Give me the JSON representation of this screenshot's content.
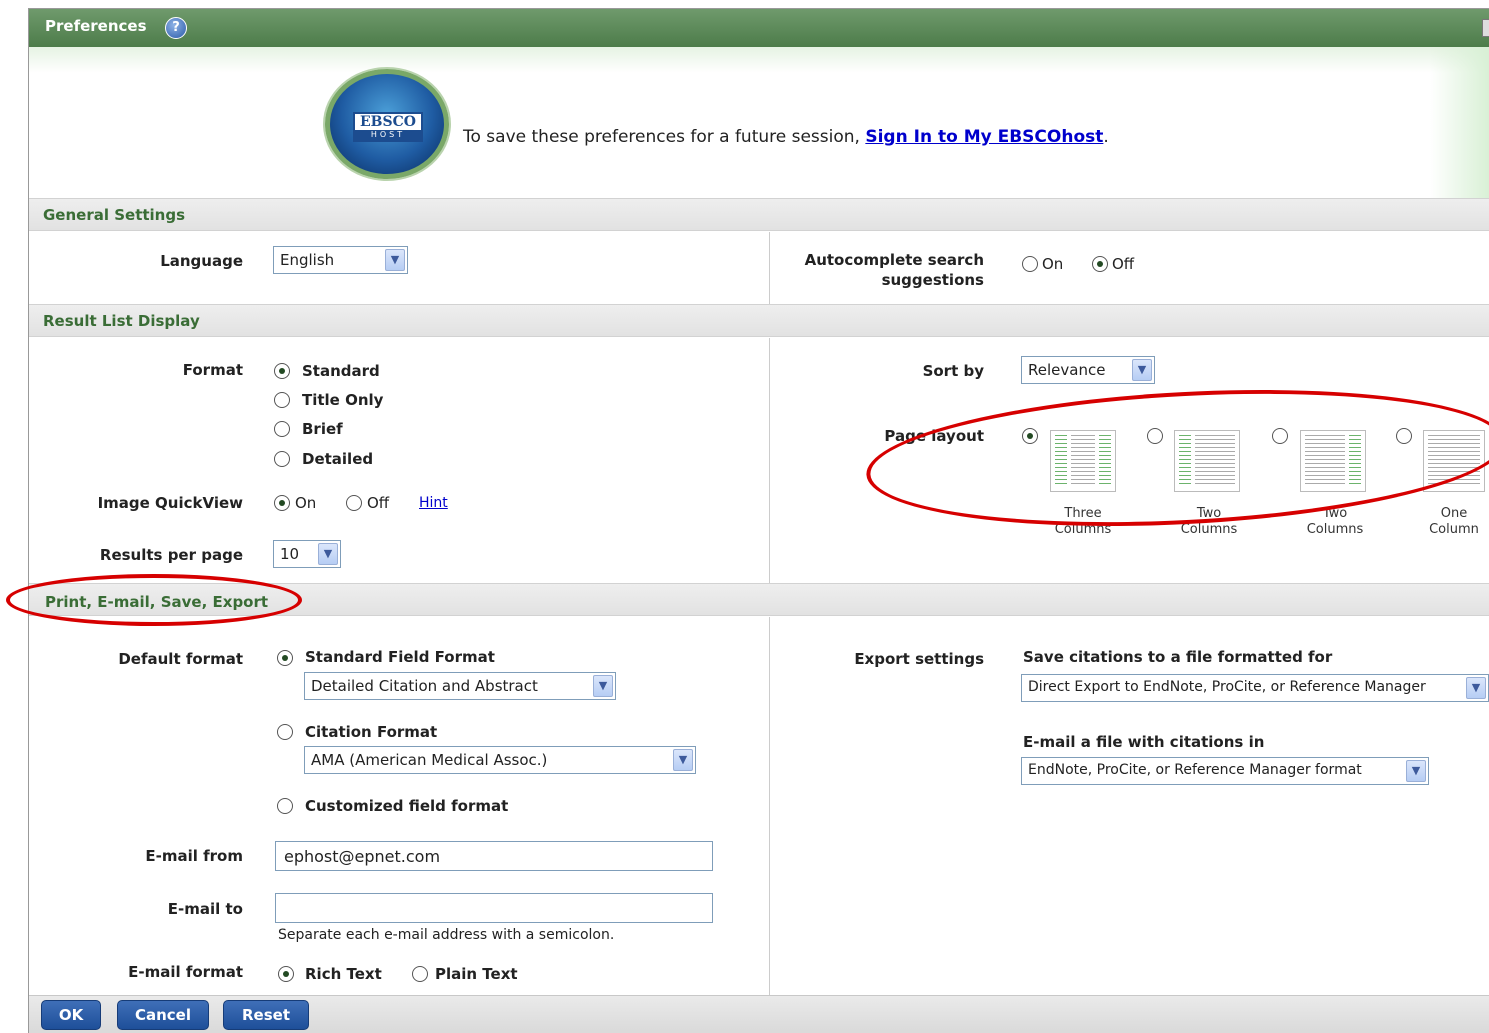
{
  "header": {
    "title": "Preferences",
    "help_icon": "?"
  },
  "banner": {
    "logo_line1": "EBSCO",
    "logo_line2": "HOST",
    "message": "To save these preferences for a future session, ",
    "link": "Sign In to My EBSCOhost",
    "period": "."
  },
  "general": {
    "section_title": "General Settings",
    "language_label": "Language",
    "language_value": "English",
    "autocomplete_label_1": "Autocomplete search",
    "autocomplete_label_2": "suggestions",
    "autocomplete_on": "On",
    "autocomplete_off": "Off",
    "autocomplete_selected": "Off"
  },
  "result_list": {
    "section_title": "Result List Display",
    "format_label": "Format",
    "format_options": [
      "Standard",
      "Title Only",
      "Brief",
      "Detailed"
    ],
    "format_selected": "Standard",
    "quickview_label": "Image QuickView",
    "quickview_on": "On",
    "quickview_off": "Off",
    "quickview_hint": "Hint",
    "results_per_page_label": "Results per page",
    "results_per_page_value": "10",
    "sort_by_label": "Sort by",
    "sort_by_value": "Relevance",
    "page_layout_label": "Page layout",
    "layouts": [
      {
        "caption_1": "Three",
        "caption_2": "Columns"
      },
      {
        "caption_1": "Two",
        "caption_2": "Columns"
      },
      {
        "caption_1": "Two",
        "caption_2": "Columns"
      },
      {
        "caption_1": "One",
        "caption_2": "Column"
      }
    ],
    "layout_selected": "Three Columns"
  },
  "export": {
    "section_title": "Print, E-mail, Save, Export",
    "default_format_label": "Default format",
    "standard_field_format": "Standard Field Format",
    "standard_field_value": "Detailed Citation and Abstract",
    "citation_format": "Citation Format",
    "citation_value": "AMA (American Medical Assoc.)",
    "customized_field_format": "Customized field format",
    "default_selected": "Standard Field Format",
    "email_from_label": "E-mail from",
    "email_from_value": "ephost@epnet.com",
    "email_to_label": "E-mail to",
    "email_to_value": "",
    "email_to_hint": "Separate each e-mail address with a semicolon.",
    "email_format_label": "E-mail format",
    "rich_text": "Rich Text",
    "plain_text": "Plain Text",
    "email_format_selected": "Rich Text",
    "export_settings_label": "Export settings",
    "save_citations_label": "Save citations to a file formatted for",
    "save_citations_value": "Direct Export to EndNote, ProCite, or Reference Manager",
    "email_citations_label": "E-mail a file with citations in",
    "email_citations_value": "EndNote, ProCite, or Reference Manager format"
  },
  "footer": {
    "ok": "OK",
    "cancel": "Cancel",
    "reset": "Reset"
  },
  "colors": {
    "header_green": "#4d7c4a",
    "section_title_green": "#3a6d36",
    "annotation_red": "#d60000",
    "button_blue": "#1e4f99"
  }
}
